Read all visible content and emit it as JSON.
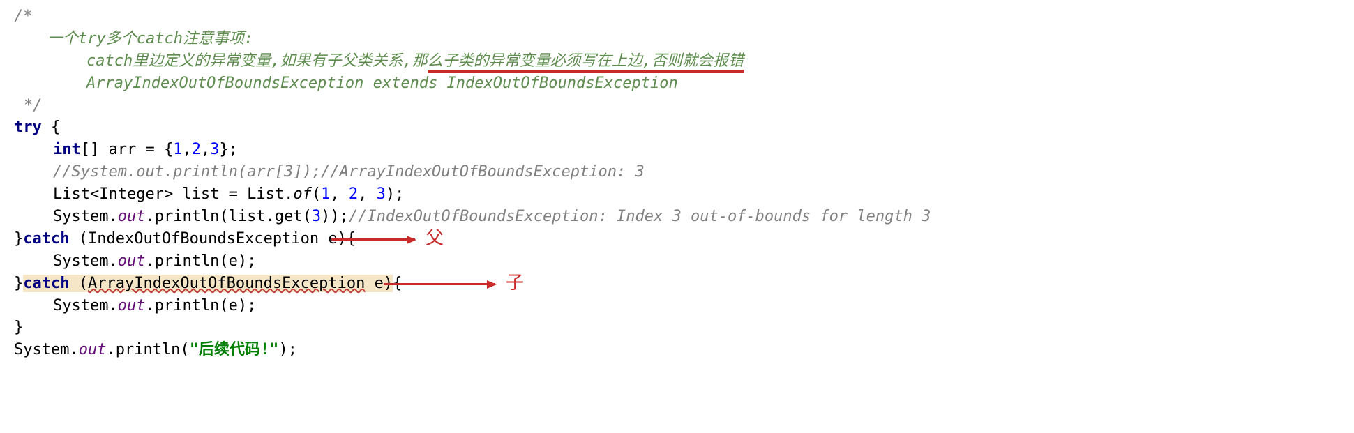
{
  "comment": {
    "open": "/*",
    "l1_prefix": "一个",
    "l1_try": "try",
    "l1_mid": "多个",
    "l1_catch": "catch",
    "l1_suffix": "注意事项:",
    "l2_prefix": "catch",
    "l2_body_plain": "里边定义的异常变量,如果有子父类关系,那",
    "l2_body_underlined": "么子类的异常变量必须写在上边,否则就会报错",
    "l3": "ArrayIndexOutOfBoundsException extends IndexOutOfBoundsException",
    "close": "*/"
  },
  "code": {
    "try": "try",
    "int": "int",
    "arr": "arr",
    "eq": " = {",
    "n1": "1",
    "n2": "2",
    "n3": "3",
    "arr_close": "};",
    "c_arr": "//System.out.println(arr[3]);//ArrayIndexOutOfBoundsException: 3",
    "list_decl_a": "List<Integer> list = List.",
    "of": "of",
    "list_args": "(",
    "l1": "1",
    "l2": "2",
    "l3": "3",
    "list_close": ");",
    "sys1": "System.",
    "out": "out",
    "println": ".println(list.get(",
    "g3": "3",
    "println_close": "));",
    "c_idx": "//IndexOutOfBoundsException: Index 3 out-of-bounds for length 3",
    "catch1_a": "}",
    "catch": "catch",
    "catch1_b": " (IndexOutOfBoundsException e){",
    "body1a": "System.",
    "body1b": ".println(e);",
    "catch2_paren": " (",
    "catch2_ex": "ArrayIndexOutOfBoundsException",
    "catch2_e": " e",
    "catch2_close": "){",
    "body2a": "System.",
    "body2b": ".println(e);",
    "close_brace": "}",
    "final_a": "System.",
    "final_b": ".println(",
    "final_str": "\"后续代码!\"",
    "final_c": ");"
  },
  "anno": {
    "parent": "父",
    "child": "子"
  }
}
